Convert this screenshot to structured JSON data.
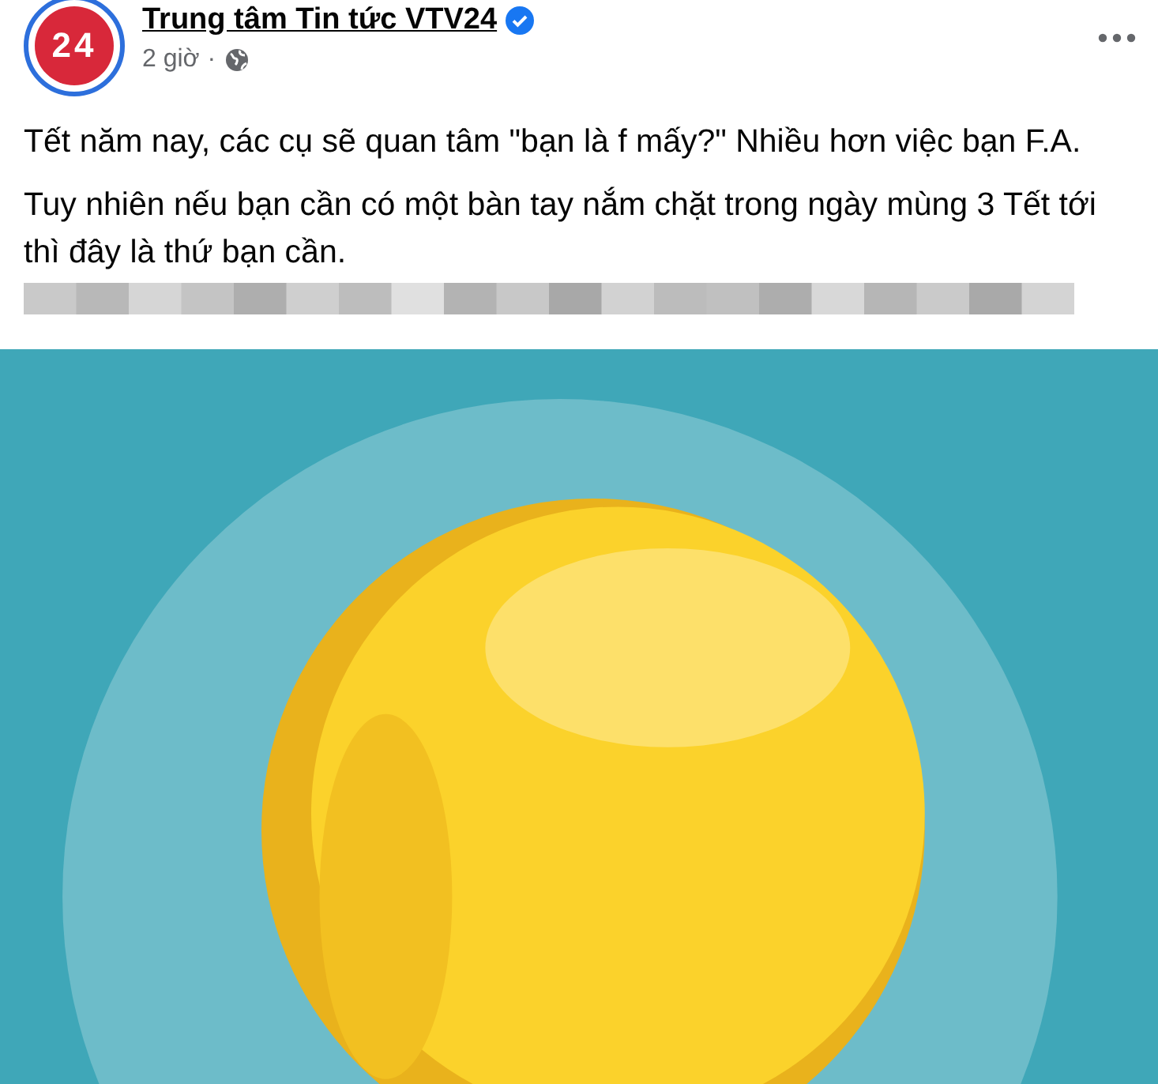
{
  "post": {
    "author": "Trung tâm Tin tức VTV24",
    "verified": true,
    "avatar_text": "24",
    "time": "2 giờ",
    "time_separator": "·",
    "paragraphs": [
      "Tết năm nay, các cụ sẽ quan tâm \"bạn là f mấy?\" Nhiều hơn việc bạn F.A.",
      "Tuy nhiên nếu bạn cần có một bàn tay nắm chặt trong ngày mùng 3 Tết tới thì đây là thứ bạn cần."
    ]
  }
}
